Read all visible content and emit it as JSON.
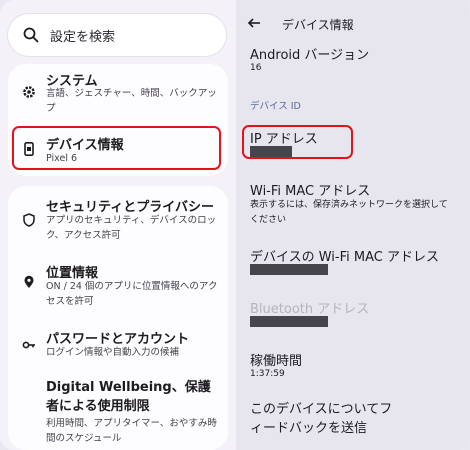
{
  "search": {
    "placeholder": "設定を検索",
    "icon": "search-icon"
  },
  "left_list": {
    "system": {
      "title": "システム",
      "sub": "言語、ジェスチャー、時間、バックアップ",
      "icon": "gear-icon"
    },
    "device_info": {
      "title": "デバイス情報",
      "sub": "Pixel 6",
      "icon": "phone-icon"
    },
    "security": {
      "title": "セキュリティとプライバシー",
      "sub": "アプリのセキュリティ、デバイスのロック、アクセス許可",
      "icon": "shield-icon"
    },
    "location": {
      "title": "位置情報",
      "sub": "ON / 24 個のアプリに位置情報へのアクセスを許可",
      "icon": "location-pin-icon"
    },
    "passwords": {
      "title": "パスワードとアカウント",
      "sub": "ログイン情報や自動入力の候補",
      "icon": "key-icon"
    },
    "wellbeing": {
      "title": "Digital Wellbeing、保護者による使用制限",
      "sub": "利用時間、アプリタイマー、おやすみ時間のスケジュール"
    }
  },
  "right_panel": {
    "header_title": "デバイス情報",
    "android_version_label": "Android バージョン",
    "android_version_value": "16",
    "section_device_id": "デバイス ID",
    "ip_address_label": "IP アドレス",
    "wifi_mac_label": "Wi-Fi MAC アドレス",
    "wifi_mac_sub": "表示するには、保存済みネットワークを選択してください",
    "device_wifi_mac_label": "デバイスの Wi-Fi MAC アドレス",
    "bluetooth_label": "Bluetooth アドレス",
    "uptime_label": "稼働時間",
    "uptime_value": "1:37:59",
    "feedback_label": "このデバイスについてフィードバックを送信"
  },
  "colors": {
    "highlight": "#e4131b",
    "accent_section": "#5a6a9a",
    "redaction": "#45454b"
  }
}
